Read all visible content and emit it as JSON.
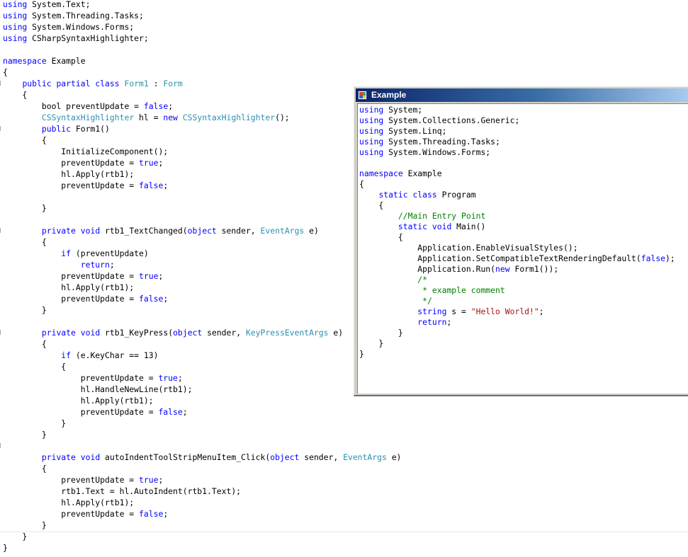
{
  "editor": {
    "lines": [
      [
        {
          "t": "using",
          "c": "kw"
        },
        {
          "t": " System.Text;"
        }
      ],
      [
        {
          "t": "using",
          "c": "kw"
        },
        {
          "t": " System.Threading.Tasks;"
        }
      ],
      [
        {
          "t": "using",
          "c": "kw"
        },
        {
          "t": " System.Windows.Forms;"
        }
      ],
      [
        {
          "t": "using",
          "c": "kw"
        },
        {
          "t": " CSharpSyntaxHighlighter;"
        }
      ],
      [],
      [
        {
          "t": "namespace",
          "c": "kw"
        },
        {
          "t": " Example"
        }
      ],
      [
        {
          "t": "{"
        }
      ],
      [
        {
          "t": "    "
        },
        {
          "t": "public",
          "c": "kw"
        },
        {
          "t": " "
        },
        {
          "t": "partial",
          "c": "kw"
        },
        {
          "t": " "
        },
        {
          "t": "class",
          "c": "kw"
        },
        {
          "t": " "
        },
        {
          "t": "Form1",
          "c": "ty"
        },
        {
          "t": " : "
        },
        {
          "t": "Form",
          "c": "ty"
        }
      ],
      [
        {
          "t": "    {"
        }
      ],
      [
        {
          "t": "        bool "
        },
        {
          "t": "preventUpdate = "
        },
        {
          "t": "false",
          "c": "kw"
        },
        {
          "t": ";"
        }
      ],
      [
        {
          "t": "        "
        },
        {
          "t": "CSSyntaxHighlighter",
          "c": "ty"
        },
        {
          "t": " hl = "
        },
        {
          "t": "new",
          "c": "kw"
        },
        {
          "t": " "
        },
        {
          "t": "CSSyntaxHighlighter",
          "c": "ty"
        },
        {
          "t": "();"
        }
      ],
      [
        {
          "t": "        "
        },
        {
          "t": "public",
          "c": "kw"
        },
        {
          "t": " Form1()"
        }
      ],
      [
        {
          "t": "        {"
        }
      ],
      [
        {
          "t": "            InitializeComponent();"
        }
      ],
      [
        {
          "t": "            preventUpdate = "
        },
        {
          "t": "true",
          "c": "kw"
        },
        {
          "t": ";"
        }
      ],
      [
        {
          "t": "            hl.Apply(rtb1);"
        }
      ],
      [
        {
          "t": "            preventUpdate = "
        },
        {
          "t": "false",
          "c": "kw"
        },
        {
          "t": ";"
        }
      ],
      [],
      [
        {
          "t": "        }"
        }
      ],
      [],
      [
        {
          "t": "        "
        },
        {
          "t": "private",
          "c": "kw"
        },
        {
          "t": " "
        },
        {
          "t": "void",
          "c": "kw"
        },
        {
          "t": " rtb1_TextChanged("
        },
        {
          "t": "object",
          "c": "kw"
        },
        {
          "t": " sender, "
        },
        {
          "t": "EventArgs",
          "c": "ty"
        },
        {
          "t": " e)"
        }
      ],
      [
        {
          "t": "        {"
        }
      ],
      [
        {
          "t": "            "
        },
        {
          "t": "if",
          "c": "kw"
        },
        {
          "t": " (preventUpdate)"
        }
      ],
      [
        {
          "t": "                "
        },
        {
          "t": "return",
          "c": "kw"
        },
        {
          "t": ";"
        }
      ],
      [
        {
          "t": "            preventUpdate = "
        },
        {
          "t": "true",
          "c": "kw"
        },
        {
          "t": ";"
        }
      ],
      [
        {
          "t": "            hl.Apply(rtb1);"
        }
      ],
      [
        {
          "t": "            preventUpdate = "
        },
        {
          "t": "false",
          "c": "kw"
        },
        {
          "t": ";"
        }
      ],
      [
        {
          "t": "        }"
        }
      ],
      [],
      [
        {
          "t": "        "
        },
        {
          "t": "private",
          "c": "kw"
        },
        {
          "t": " "
        },
        {
          "t": "void",
          "c": "kw"
        },
        {
          "t": " rtb1_KeyPress("
        },
        {
          "t": "object",
          "c": "kw"
        },
        {
          "t": " sender, "
        },
        {
          "t": "KeyPressEventArgs",
          "c": "ty"
        },
        {
          "t": " e)"
        }
      ],
      [
        {
          "t": "        {"
        }
      ],
      [
        {
          "t": "            "
        },
        {
          "t": "if",
          "c": "kw"
        },
        {
          "t": " (e.KeyChar == 13)"
        }
      ],
      [
        {
          "t": "            {"
        }
      ],
      [
        {
          "t": "                preventUpdate = "
        },
        {
          "t": "true",
          "c": "kw"
        },
        {
          "t": ";"
        }
      ],
      [
        {
          "t": "                hl.HandleNewLine(rtb1);"
        }
      ],
      [
        {
          "t": "                hl.Apply(rtb1);"
        }
      ],
      [
        {
          "t": "                preventUpdate = "
        },
        {
          "t": "false",
          "c": "kw"
        },
        {
          "t": ";"
        }
      ],
      [
        {
          "t": "            }"
        }
      ],
      [
        {
          "t": "        }"
        }
      ],
      [],
      [
        {
          "t": "        "
        },
        {
          "t": "private",
          "c": "kw"
        },
        {
          "t": " "
        },
        {
          "t": "void",
          "c": "kw"
        },
        {
          "t": " autoIndentToolStripMenuItem_Click("
        },
        {
          "t": "object",
          "c": "kw"
        },
        {
          "t": " sender, "
        },
        {
          "t": "EventArgs",
          "c": "ty"
        },
        {
          "t": " e)"
        }
      ],
      [
        {
          "t": "        {"
        }
      ],
      [
        {
          "t": "            preventUpdate = "
        },
        {
          "t": "true",
          "c": "kw"
        },
        {
          "t": ";"
        }
      ],
      [
        {
          "t": "            rtb1.Text = hl.AutoIndent(rtb1.Text);"
        }
      ],
      [
        {
          "t": "            hl.Apply(rtb1);"
        }
      ],
      [
        {
          "t": "            preventUpdate = "
        },
        {
          "t": "false",
          "c": "kw"
        },
        {
          "t": ";"
        }
      ],
      [
        {
          "t": "        }"
        }
      ],
      [
        {
          "t": "    }"
        }
      ],
      [
        {
          "t": "}"
        }
      ]
    ]
  },
  "window": {
    "title": "Example",
    "icon": "winforms-app-icon",
    "code": [
      [
        {
          "t": "using",
          "c": "kw"
        },
        {
          "t": " System;"
        }
      ],
      [
        {
          "t": "using",
          "c": "kw"
        },
        {
          "t": " System.Collections.Generic;"
        }
      ],
      [
        {
          "t": "using",
          "c": "kw"
        },
        {
          "t": " System.Linq;"
        }
      ],
      [
        {
          "t": "using",
          "c": "kw"
        },
        {
          "t": " System.Threading.Tasks;"
        }
      ],
      [
        {
          "t": "using",
          "c": "kw"
        },
        {
          "t": " System.Windows.Forms;"
        }
      ],
      [],
      [
        {
          "t": "namespace",
          "c": "kw"
        },
        {
          "t": " Example"
        }
      ],
      [
        {
          "t": "{"
        }
      ],
      [
        {
          "t": "    "
        },
        {
          "t": "static",
          "c": "kw"
        },
        {
          "t": " "
        },
        {
          "t": "class",
          "c": "kw"
        },
        {
          "t": " Program"
        }
      ],
      [
        {
          "t": "    {"
        }
      ],
      [
        {
          "t": "        "
        },
        {
          "t": "//Main Entry Point",
          "c": "cm"
        }
      ],
      [
        {
          "t": "        "
        },
        {
          "t": "static",
          "c": "kw"
        },
        {
          "t": " "
        },
        {
          "t": "void",
          "c": "kw"
        },
        {
          "t": " Main()"
        }
      ],
      [
        {
          "t": "        {"
        }
      ],
      [
        {
          "t": "            Application.EnableVisualStyles();"
        }
      ],
      [
        {
          "t": "            Application.SetCompatibleTextRenderingDefault("
        },
        {
          "t": "false",
          "c": "kw"
        },
        {
          "t": ");"
        }
      ],
      [
        {
          "t": "            Application.Run("
        },
        {
          "t": "new",
          "c": "kw"
        },
        {
          "t": " Form1());"
        }
      ],
      [
        {
          "t": "            "
        },
        {
          "t": "/*",
          "c": "cm"
        }
      ],
      [
        {
          "t": "             "
        },
        {
          "t": "* example comment",
          "c": "cm"
        }
      ],
      [
        {
          "t": "             "
        },
        {
          "t": "*/",
          "c": "cm"
        }
      ],
      [
        {
          "t": "            "
        },
        {
          "t": "string",
          "c": "kw"
        },
        {
          "t": " s = "
        },
        {
          "t": "\"Hello World!\"",
          "c": "st"
        },
        {
          "t": ";"
        }
      ],
      [
        {
          "t": "            "
        },
        {
          "t": "return",
          "c": "kw"
        },
        {
          "t": ";"
        }
      ],
      [
        {
          "t": "        }"
        }
      ],
      [
        {
          "t": "    }"
        }
      ],
      [
        {
          "t": "}"
        }
      ]
    ]
  },
  "colors": {
    "keyword": "#0000ff",
    "type": "#2b91af",
    "comment": "#008000",
    "string": "#a31515",
    "titlebar": "#0a246a"
  }
}
